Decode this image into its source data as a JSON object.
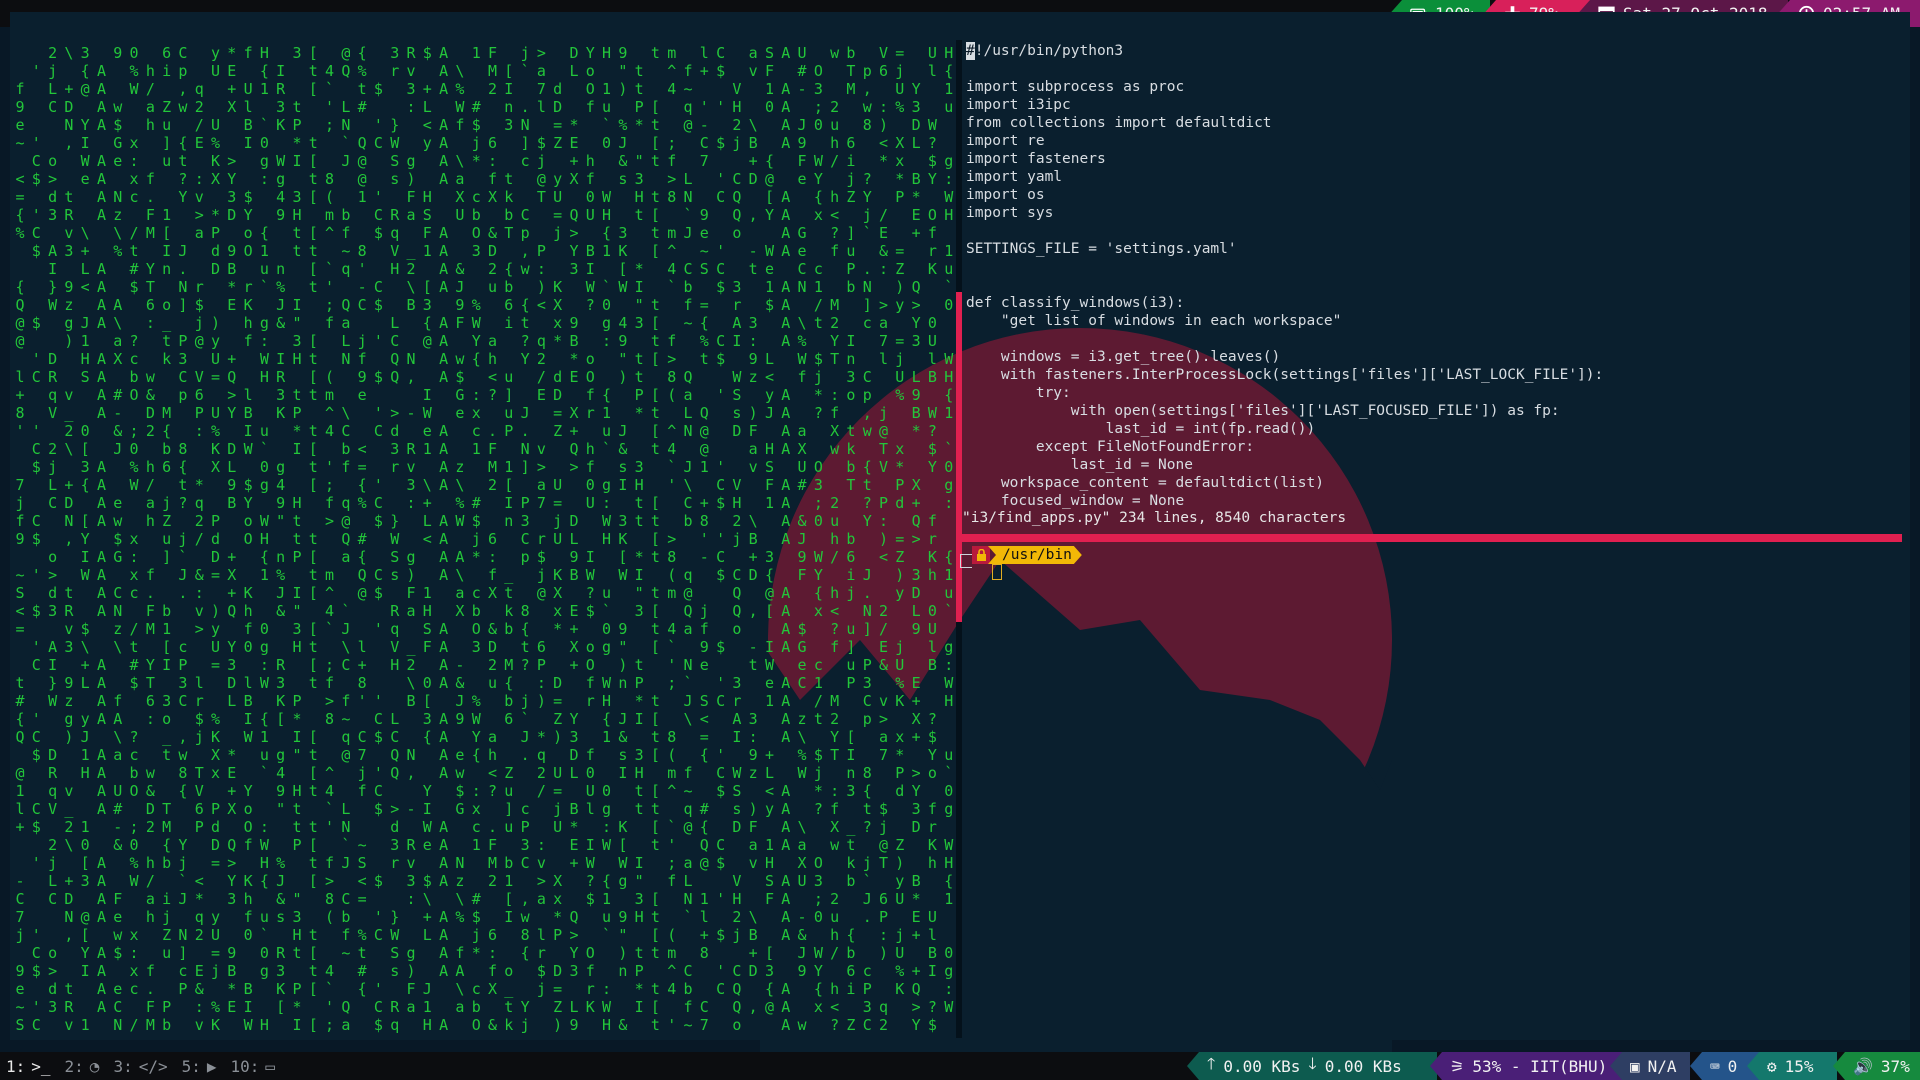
{
  "topbar": {
    "battery": "100%",
    "brightness": "79%",
    "date": "Sat 27 Oct 2018",
    "time": "02:57 AM"
  },
  "editor": {
    "lines": [
      "#!/usr/bin/python3",
      "",
      "import subprocess as proc",
      "import i3ipc",
      "from collections import defaultdict",
      "import re",
      "import fasteners",
      "import yaml",
      "import os",
      "import sys",
      "",
      "SETTINGS_FILE = 'settings.yaml'",
      "",
      "",
      "def classify_windows(i3):",
      "    \"get list of windows in each workspace\"",
      "",
      "    windows = i3.get_tree().leaves()",
      "    with fasteners.InterProcessLock(settings['files']['LAST_LOCK_FILE']):",
      "        try:",
      "            with open(settings['files']['LAST_FOCUSED_FILE']) as fp:",
      "                last_id = int(fp.read())",
      "        except FileNotFoundError:",
      "            last_id = None",
      "    workspace_content = defaultdict(list)",
      "    focused_window = None"
    ],
    "cursor_char": "#",
    "status": "\"i3/find_apps.py\" 234 lines, 8540 characters"
  },
  "terminal": {
    "path": "/usr/bin"
  },
  "workspaces": [
    {
      "num": "1:",
      "icon": "terminal-icon",
      "glyph": ">_",
      "active": true
    },
    {
      "num": "2:",
      "icon": "firefox-icon",
      "glyph": "",
      "active": false
    },
    {
      "num": "3:",
      "icon": "code-icon",
      "glyph": "</>",
      "active": false
    },
    {
      "num": "5:",
      "icon": "play-icon",
      "glyph": "",
      "active": false
    },
    {
      "num": "10:",
      "icon": "monitor-icon",
      "glyph": "",
      "active": false
    }
  ],
  "bottombar": {
    "upload": "0.00 KBs",
    "download": "0.00 KBs",
    "wifi": "53% - IIT(BHU)",
    "battery2": "N/A",
    "keyboard": "0",
    "disk": "15%",
    "volume": "37%"
  },
  "matrix": {
    "columns": [
      "7<Q'etlj=@-~#+f{@CS{89%1",
      "$C' ",
      "RSI3oC2qs}r>QjVDWAdQLH",
      ",+2ag:R D\\v)9v-NB_Fz3t",
      "SIJ@L[$FW1[<3\\1eHYy{+01",
      "A",
      "$AF%&NUG\\eWJz#eawf9\\-CX",
      "O?$/x{%3cjtcxW;b*#1:Y0",
      "?au&fTMfhhDX62.</2w:YF",
      "utZ36[MPkuoiI{bb]_jnb1T",
      "tp]j83.?,c`{CNYwPJ",
      "jql)>6&@2r<aP:T/$*7:vVE",
      "Ud=*yXZ%DjPUx)K=",
      "*++>3LBEXQYD9",
      "o0$hWrBOUYf?KIfl",
      "H`Wu:1g{0",
      "sgJ[n3\"I4&W%K)R9",
      "ttH3\"I*P",
      ":AGGKttJ}t16[2",
      "m`f(4;8^'>",
      "fqQL`\\b~@aNJC"
    ]
  }
}
